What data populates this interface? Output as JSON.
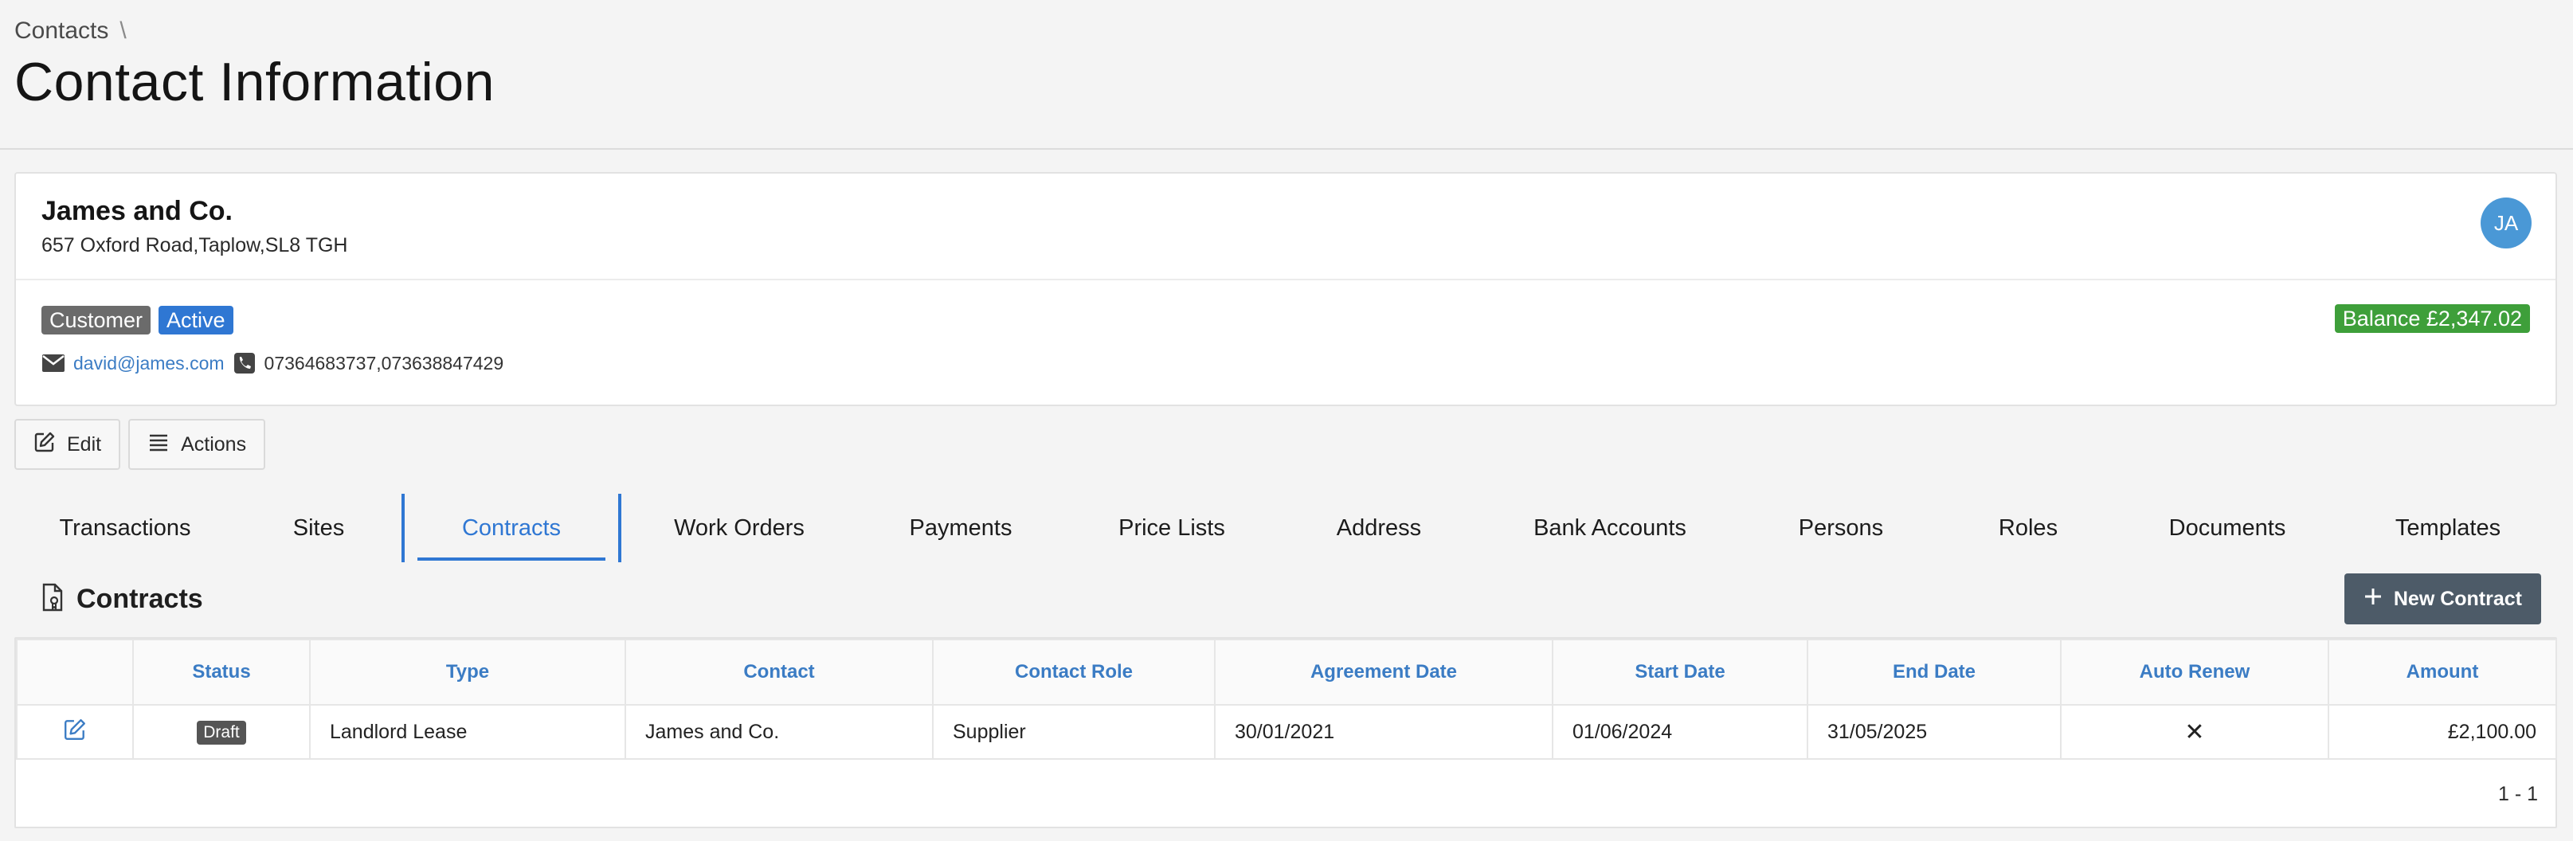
{
  "breadcrumb": {
    "root": "Contacts",
    "separator": "\\"
  },
  "page_title": "Contact Information",
  "contact": {
    "name": "James and Co.",
    "address": "657 Oxford Road,Taplow,SL8 TGH",
    "avatar_initials": "JA",
    "badges": [
      "Customer",
      "Active"
    ],
    "balance": "Balance £2,347.02",
    "email": "david@james.com",
    "phone": "07364683737,073638847429"
  },
  "buttons": {
    "edit": "Edit",
    "actions": "Actions"
  },
  "tabs": [
    "Transactions",
    "Sites",
    "Contracts",
    "Work Orders",
    "Payments",
    "Price Lists",
    "Address",
    "Bank Accounts",
    "Persons",
    "Roles",
    "Documents",
    "Templates"
  ],
  "active_tab": "Contracts",
  "section": {
    "title": "Contracts",
    "new_button": "New Contract"
  },
  "table": {
    "columns": [
      "",
      "Status",
      "Type",
      "Contact",
      "Contact Role",
      "Agreement Date",
      "Start Date",
      "End Date",
      "Auto Renew",
      "Amount"
    ],
    "rows": [
      {
        "status": "Draft",
        "type": "Landlord Lease",
        "contact": "James and Co.",
        "role": "Supplier",
        "agreement_date": "30/01/2021",
        "start_date": "01/06/2024",
        "end_date": "31/05/2025",
        "auto_renew": "✕",
        "amount": "£2,100.00"
      }
    ]
  },
  "pager": "1 - 1",
  "colors": {
    "accent": "#2f77d3",
    "link": "#3b7cc4",
    "balance": "#3e9f3a",
    "primary_button": "#4d5b68"
  },
  "icons": [
    "mail-icon",
    "phone-icon",
    "edit-icon",
    "menu-icon",
    "document-icon",
    "plus-icon",
    "row-edit-icon",
    "x-icon"
  ]
}
